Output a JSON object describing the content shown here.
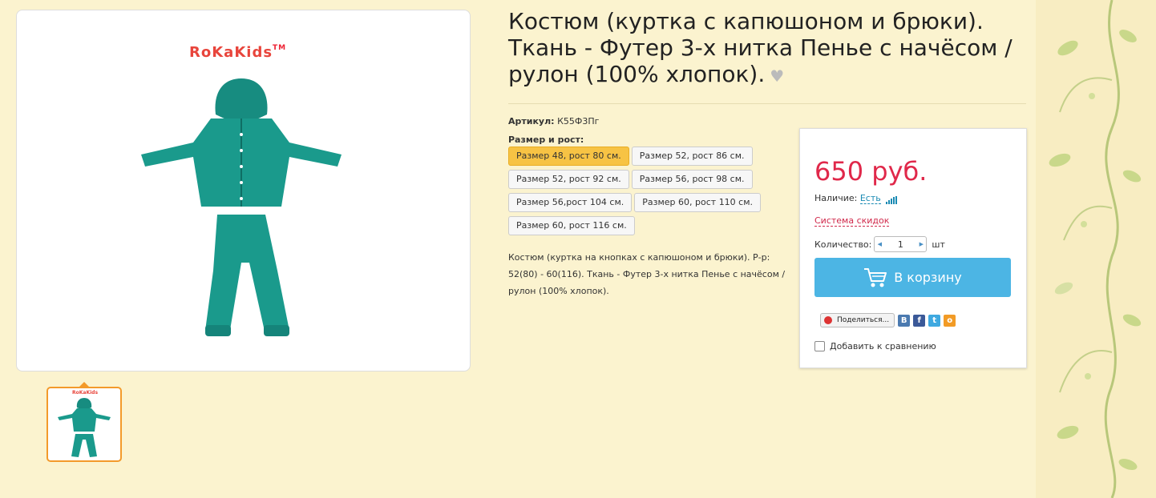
{
  "product": {
    "title": "Костюм (куртка с капюшоном и брюки). Ткань - Футер 3-х нитка Пенье с начёсом / рулон (100% хлопок).",
    "brand_logo": "RoKaKids",
    "brand_tm": "TM",
    "article_label": "Артикул:",
    "article_value": "К55Ф3Пг",
    "size_label": "Размер и рост:",
    "sizes": [
      "Размер 48, рост 80 см.",
      "Размер 52, рост 86 см.",
      "Размер 52, рост 92 см.",
      "Размер 56, рост 98 см.",
      "Размер 56,рост 104 см.",
      "Размер 60, рост 110 см.",
      "Размер 60, рост 116 см."
    ],
    "selected_size_index": 0,
    "description": "Костюм (куртка на кнопках с капюшоном и брюки). Р-р: 52(80) - 60(116). Ткань - Футер 3-х нитка Пенье с начёсом / рулон (100% хлопок).",
    "product_color": "#1a9a8c"
  },
  "buy_box": {
    "price": "650 руб.",
    "availability_label": "Наличие:",
    "availability_value": "Есть",
    "discounts_link": "Система скидок",
    "quantity_label": "Количество:",
    "quantity_value": "1",
    "quantity_unit": "шт",
    "cart_button": "В корзину",
    "share_button": "Поделиться...",
    "compare_label": "Добавить к сравнению"
  },
  "colors": {
    "accent_price": "#e0284a",
    "cart_button": "#4cb5e4",
    "selected_size": "#f7c344",
    "thumb_border": "#f39a2b"
  },
  "social_icons": [
    "vk-icon",
    "facebook-icon",
    "twitter-icon",
    "odnoklassniki-icon"
  ]
}
